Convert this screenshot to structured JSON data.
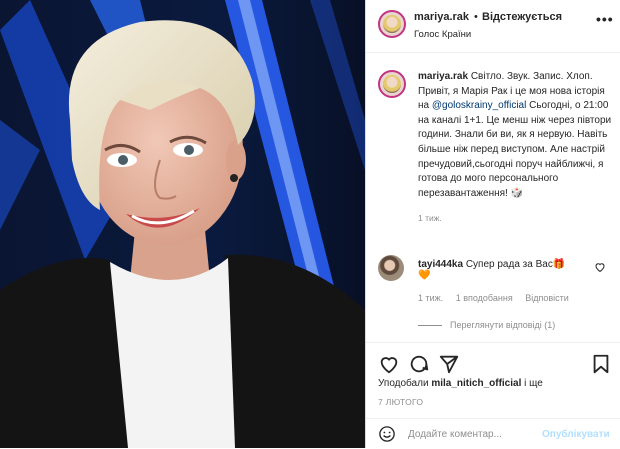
{
  "post": {
    "username": "mariya.rak",
    "separator": "•",
    "follow_label": "Відстежується",
    "location": "Голос Країни",
    "more": "•••"
  },
  "caption": {
    "username": "mariya.rak",
    "text_before_mention": "Світло. Звук. Запис. Хлоп. Привіт, я Марія Рак і це моя нова історія на",
    "mention": "@goloskrainy_official",
    "text_after_mention": "Сьогодні, о 21:00 на каналі 1+1. Це менш ніж через півтори години. Знали би ви, як я нервую. Навіть більше ніж перед виступом. Але настрій пречудовий,сьогодні поруч найближчі, я готова до мого персонального перезавантаження!",
    "emoji": "🎲",
    "time": "1 тиж."
  },
  "comment": {
    "username": "tayi444ka",
    "text": "Супер рада за Вас",
    "emoji1": "🎁",
    "emoji2": "🧡",
    "time": "1 тиж.",
    "likes": "1 вподобання",
    "reply": "Відповісти",
    "view_replies": "Переглянути відповіді (1)"
  },
  "likes": {
    "prefix": "Уподобали",
    "user": "mila_nitich_official",
    "suffix": "і ще"
  },
  "date": "7 ЛЮТОГО",
  "add_comment": {
    "placeholder": "Додайте коментар...",
    "publish": "Опублікувати"
  },
  "icons": {
    "like": "heart-icon",
    "comment": "comment-icon",
    "share": "share-icon",
    "save": "bookmark-icon",
    "emoji": "smile-icon"
  }
}
